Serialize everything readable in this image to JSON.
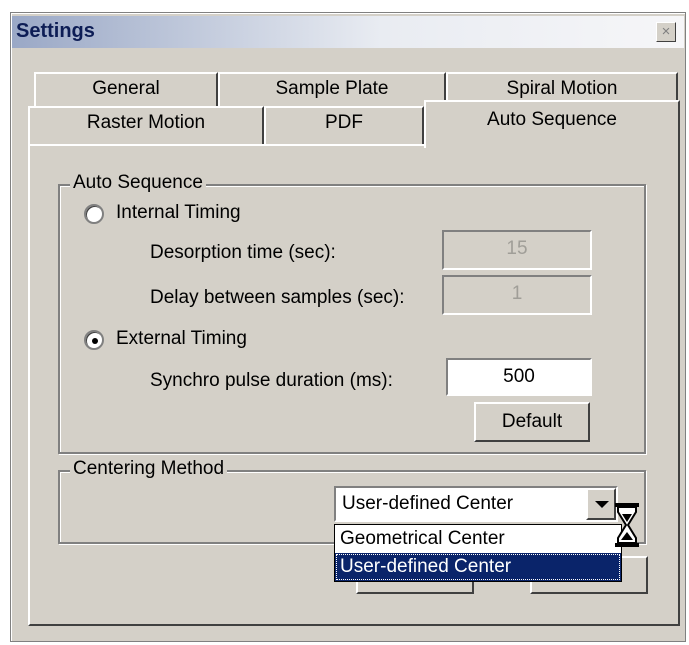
{
  "window": {
    "title": "Settings",
    "close_label": "×"
  },
  "tabs": {
    "row1": [
      "General",
      "Sample Plate",
      "Spiral Motion"
    ],
    "row2": [
      "Raster Motion",
      "PDF",
      "Auto Sequence"
    ],
    "active": "Auto Sequence"
  },
  "auto_sequence": {
    "legend": "Auto Sequence",
    "internal_timing": {
      "label": "Internal Timing",
      "selected": false
    },
    "desorption": {
      "label": "Desorption time (sec):",
      "value": "15"
    },
    "delay": {
      "label": "Delay between samples (sec):",
      "value": "1"
    },
    "external_timing": {
      "label": "External Timing",
      "selected": true
    },
    "synchro": {
      "label": "Synchro pulse duration (ms):",
      "value": "500"
    },
    "default_button": "Default"
  },
  "centering": {
    "legend": "Centering Method",
    "selected": "User-defined Center",
    "options": [
      "Geometrical Center",
      "User-defined Center"
    ],
    "highlighted_index": 1
  },
  "cursor": {
    "icon": "hourglass-icon"
  },
  "colors": {
    "face": "#d4d0c8",
    "highlight": "#0a246a",
    "title_text": "#0d1d55"
  }
}
